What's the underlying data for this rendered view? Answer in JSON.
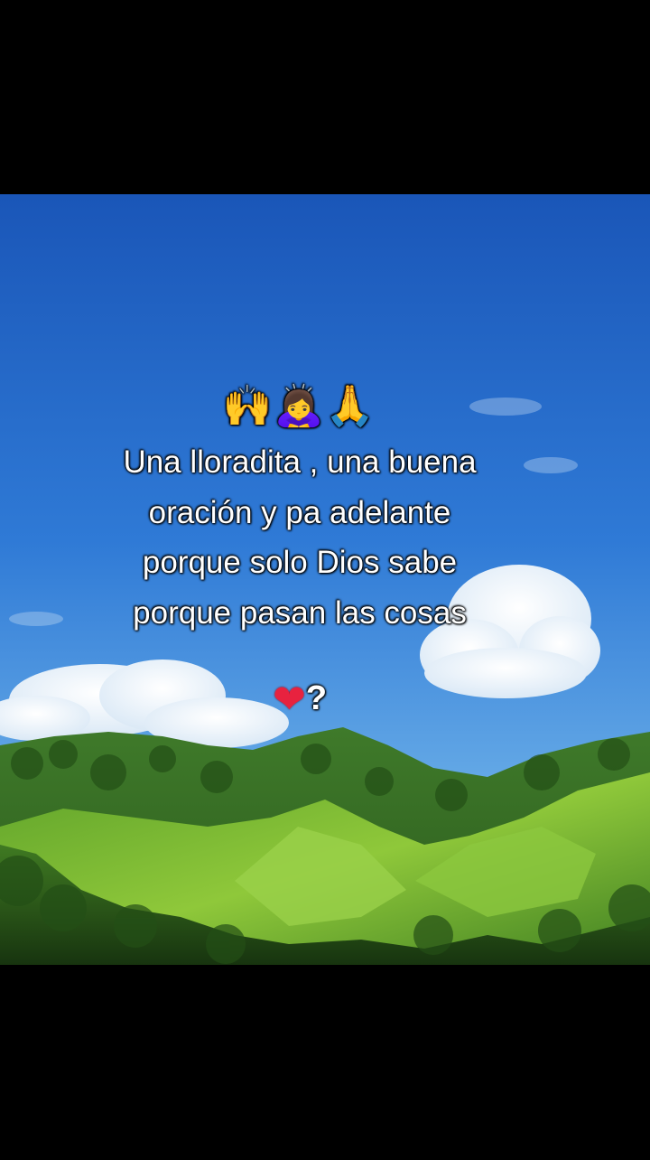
{
  "caption": {
    "emojis": {
      "raised_hands": "🙌",
      "bowing_person": "🙇‍♀️",
      "folded_hands": "🙏"
    },
    "lines": [
      "Una lloradita , una buena",
      "oración y pa adelante",
      "porque solo Dios sabe",
      "porque pasan las cosas"
    ],
    "tail_heart": "❤",
    "tail_mark": "?"
  },
  "colors": {
    "sky_top": "#1f5fc0",
    "sky_bottom": "#5fa8e6",
    "cloud": "#ffffff",
    "hill_dark": "#1f4a18",
    "hill_light": "#7fbf2e",
    "text": "#ffffff",
    "heart": "#e8223f",
    "letterbox": "#000000"
  }
}
